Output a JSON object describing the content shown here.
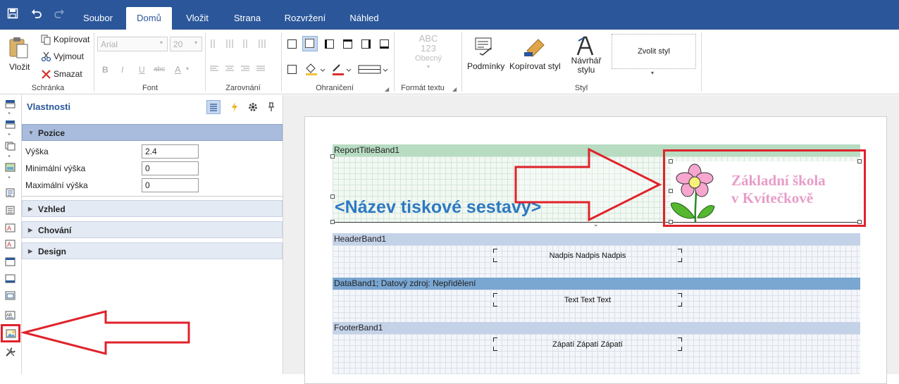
{
  "colors": {
    "accent": "#2b579a",
    "highlight": "#e0222b",
    "title_text": "#2d79c2",
    "logo_text": "#e89cc8"
  },
  "quick_access": {
    "save_icon": "save-icon",
    "undo_icon": "undo-icon",
    "redo_icon": "redo-icon"
  },
  "tabs": [
    {
      "label": "Soubor"
    },
    {
      "label": "Domů",
      "active": true
    },
    {
      "label": "Vložit"
    },
    {
      "label": "Strana"
    },
    {
      "label": "Rozvržení"
    },
    {
      "label": "Náhled"
    }
  ],
  "ribbon": {
    "clipboard": {
      "group_label": "Schránka",
      "paste_label": "Vložit",
      "copy_label": "Kopírovat",
      "cut_label": "Vyjmout",
      "delete_label": "Smazat"
    },
    "font": {
      "group_label": "Font",
      "family_value": "Arial",
      "size_value": "20",
      "bold": "B",
      "italic": "I",
      "underline": "U",
      "strike": "abc",
      "color": "A"
    },
    "alignment": {
      "group_label": "Zarovnání"
    },
    "border": {
      "group_label": "Ohraničení"
    },
    "text_format": {
      "group_label": "Formát textu",
      "sample_line1": "ABC",
      "sample_line2": "123",
      "sample_line3": "Obecný"
    },
    "style": {
      "group_label": "Styl",
      "conditions_label": "Podmínky",
      "copy_style_label": "Kopírovat styl",
      "designer_label_line1": "Návrhář",
      "designer_label_line2": "stylu",
      "choose_style_label": "Zvolit styl"
    }
  },
  "properties_panel": {
    "title": "Vlastnosti",
    "categories": [
      {
        "label": "Pozice",
        "expanded": true
      },
      {
        "label": "Vzhled",
        "expanded": false
      },
      {
        "label": "Chování",
        "expanded": false
      },
      {
        "label": "Design",
        "expanded": false
      }
    ],
    "properties": [
      {
        "label": "Výška",
        "value": "2.4"
      },
      {
        "label": "Minimální výška",
        "value": "0"
      },
      {
        "label": "Maximální výška",
        "value": "0"
      }
    ]
  },
  "report": {
    "title_band": {
      "label": "ReportTitleBand1",
      "title_text": "<Název tiskové sestavy>",
      "logo_line1": "Základní škola",
      "logo_line2": "v Kvítečkově"
    },
    "header_band": {
      "label": "HeaderBand1",
      "text": "Nadpis Nadpis Nadpis"
    },
    "data_band": {
      "label": "DataBand1; Datový zdroj: Nepřidělení",
      "text": "Text Text Text"
    },
    "footer_band": {
      "label": "FooterBand1",
      "text": "Zápatí Zápatí Zápatí"
    }
  }
}
